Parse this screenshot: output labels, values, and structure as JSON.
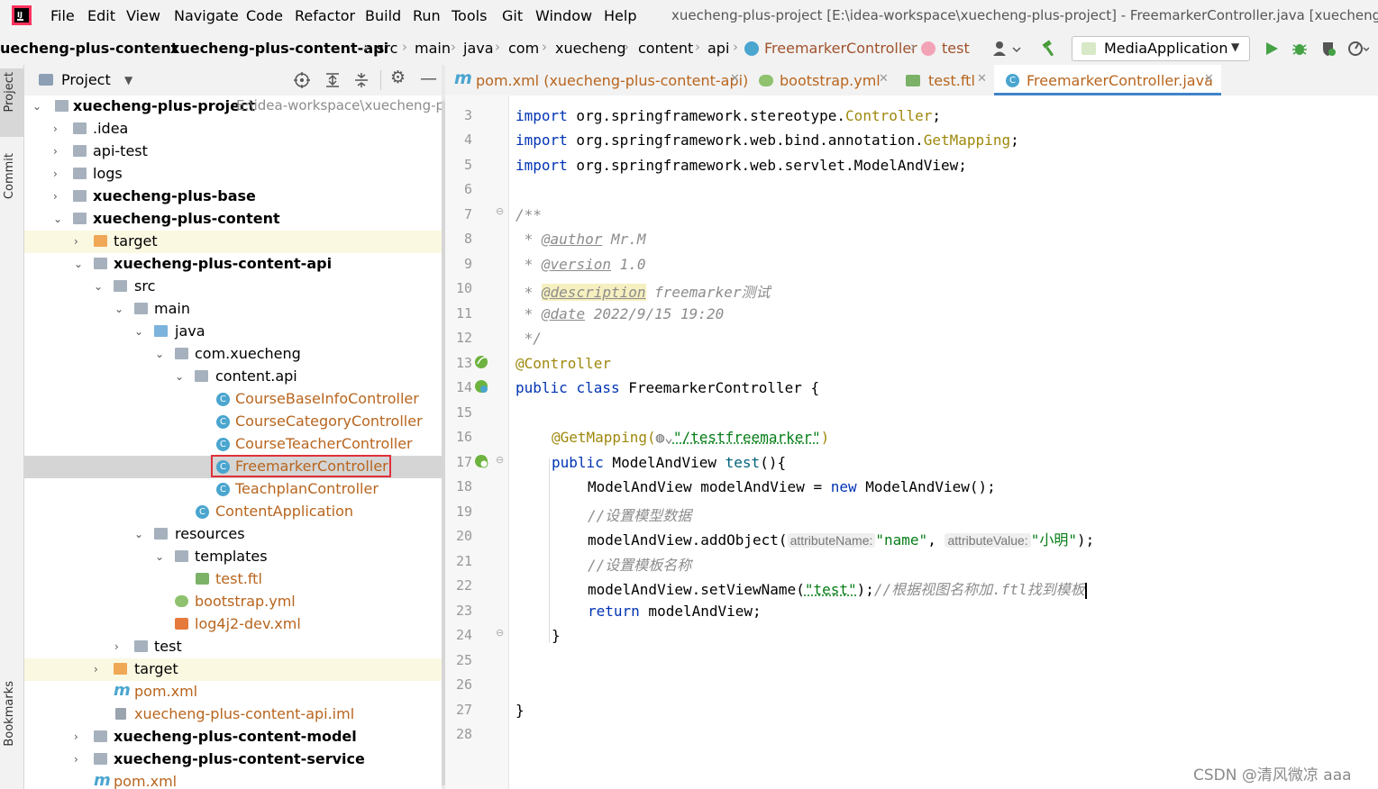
{
  "menu": [
    "File",
    "Edit",
    "View",
    "Navigate",
    "Code",
    "Refactor",
    "Build",
    "Run",
    "Tools",
    "Git",
    "Window",
    "Help"
  ],
  "window_title": "xuecheng-plus-project [E:\\idea-workspace\\xuecheng-plus-project] - FreemarkerController.java [xuecheng-p",
  "breadcrumbs": [
    "uecheng-plus-content",
    "xuecheng-plus-content-api",
    "src",
    "main",
    "java",
    "com",
    "xuecheng",
    "content",
    "api",
    "FreemarkerController",
    "test"
  ],
  "run_config": "MediaApplication",
  "project_header": "Project",
  "side_tabs": {
    "project": "Project",
    "commit": "Commit",
    "bookmarks": "Bookmarks"
  },
  "tree": [
    {
      "label": "xuecheng-plus-project",
      "extra": "E:\\idea-workspace\\xuecheng-pl",
      "depth": 0,
      "bold": true
    },
    {
      "label": ".idea",
      "depth": 1
    },
    {
      "label": "api-test",
      "depth": 1
    },
    {
      "label": "logs",
      "depth": 1
    },
    {
      "label": "xuecheng-plus-base",
      "depth": 1,
      "bold": true
    },
    {
      "label": "xuecheng-plus-content",
      "depth": 1,
      "bold": true
    },
    {
      "label": "target",
      "depth": 2
    },
    {
      "label": "xuecheng-plus-content-api",
      "depth": 2,
      "bold": true
    },
    {
      "label": "src",
      "depth": 3
    },
    {
      "label": "main",
      "depth": 4
    },
    {
      "label": "java",
      "depth": 5
    },
    {
      "label": "com.xuecheng",
      "depth": 6
    },
    {
      "label": "content.api",
      "depth": 7
    },
    {
      "label": "CourseBaseInfoController",
      "depth": 8
    },
    {
      "label": "CourseCategoryController",
      "depth": 8
    },
    {
      "label": "CourseTeacherController",
      "depth": 8
    },
    {
      "label": "FreemarkerController",
      "depth": 8
    },
    {
      "label": "TeachplanController",
      "depth": 8
    },
    {
      "label": "ContentApplication",
      "depth": 7
    },
    {
      "label": "resources",
      "depth": 5
    },
    {
      "label": "templates",
      "depth": 6
    },
    {
      "label": "test.ftl",
      "depth": 7
    },
    {
      "label": "bootstrap.yml",
      "depth": 6
    },
    {
      "label": "log4j2-dev.xml",
      "depth": 6
    },
    {
      "label": "test",
      "depth": 4
    },
    {
      "label": "target",
      "depth": 3
    },
    {
      "label": "pom.xml",
      "depth": 3
    },
    {
      "label": "xuecheng-plus-content-api.iml",
      "depth": 3
    },
    {
      "label": "xuecheng-plus-content-model",
      "depth": 2,
      "bold": true
    },
    {
      "label": "xuecheng-plus-content-service",
      "depth": 2,
      "bold": true
    },
    {
      "label": "pom.xml",
      "depth": 2
    }
  ],
  "tabs": [
    "pom.xml (xuecheng-plus-content-api)",
    "bootstrap.yml",
    "test.ftl",
    "FreemarkerController.java"
  ],
  "line_numbers": [
    "3",
    "4",
    "5",
    "6",
    "7",
    "8",
    "9",
    "10",
    "11",
    "12",
    "13",
    "14",
    "15",
    "16",
    "17",
    "18",
    "19",
    "20",
    "21",
    "22",
    "23",
    "24",
    "25",
    "26",
    "27",
    "28"
  ],
  "code": {
    "l3": [
      "import",
      " org.springframework.stereotype.",
      "Controller",
      ";"
    ],
    "l4": [
      "import",
      " org.springframework.web.bind.annotation.",
      "GetMapping",
      ";"
    ],
    "l5": [
      "import",
      " org.springframework.web.servlet.ModelAndView;"
    ],
    "l7": "/**",
    "l8": [
      " * ",
      "@author",
      " Mr.M"
    ],
    "l9": [
      " * ",
      "@version",
      " 1.0"
    ],
    "l10": [
      " * ",
      "@description",
      " freemarker测试"
    ],
    "l11": [
      " * ",
      "@date",
      " 2022/9/15 19:20"
    ],
    "l12": " */",
    "l13": "@Controller",
    "l14": [
      "public",
      " ",
      "class",
      " FreemarkerController {"
    ],
    "l16": [
      "@GetMapping(",
      "\"/testfreemarker\"",
      ")"
    ],
    "l17": [
      "public",
      " ModelAndView ",
      "test",
      "(){"
    ],
    "l18": [
      "ModelAndView modelAndView = ",
      "new",
      " ModelAndView();"
    ],
    "l19": "//设置模型数据",
    "l20": [
      "modelAndView.addObject(",
      "attributeName:",
      "\"name\"",
      ", ",
      "attributeValue:",
      "\"小明\"",
      ");"
    ],
    "l21": "//设置模板名称",
    "l22": [
      "modelAndView.setViewName(",
      "\"test\"",
      ");",
      "//根据视图名称加.ftl找到模板"
    ],
    "l23": [
      "return",
      " modelAndView;"
    ],
    "l24": "}",
    "l27": "}"
  },
  "watermark": "CSDN @清风微凉 aaa"
}
